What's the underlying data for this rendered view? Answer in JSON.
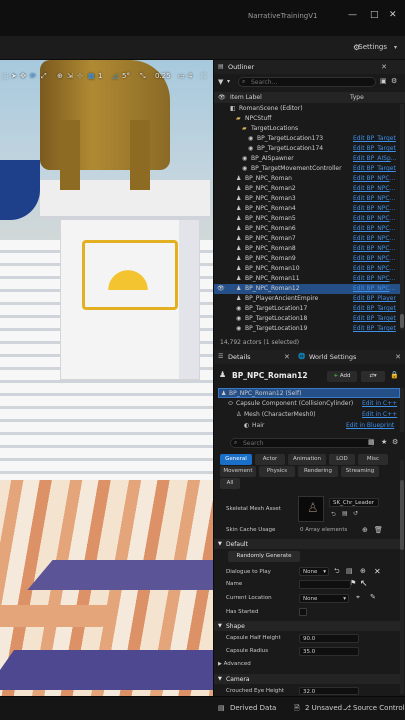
{
  "window": {
    "title": "NarrativeTrainingV1",
    "minimize": "—",
    "maximize": "□",
    "close": "✕"
  },
  "toolbar": {
    "settings_label": "Settings"
  },
  "viewport_toolbar": {
    "grid_snap": "1",
    "angle_snap": "5°",
    "scale_snap": "0.25",
    "camera_speed": "4"
  },
  "outliner": {
    "tab_label": "Outliner",
    "search_placeholder": "Search...",
    "col_label": "Item Label",
    "col_type": "Type",
    "rows": [
      {
        "label": "RomanScene (Editor)",
        "type": "",
        "indent": 1,
        "icon": "map-icon"
      },
      {
        "label": "NPCStuff",
        "type": "",
        "indent": 2,
        "icon": "folder-icon"
      },
      {
        "label": "TargetLocations",
        "type": "",
        "indent": 3,
        "icon": "folder-icon"
      },
      {
        "label": "BP_TargetLocation173",
        "type": "Edit BP_Target",
        "indent": 4,
        "icon": "actor-icon"
      },
      {
        "label": "BP_TargetLocation174",
        "type": "Edit BP_Target",
        "indent": 4,
        "icon": "actor-icon"
      },
      {
        "label": "BP_AISpawner",
        "type": "Edit BP_AISpaw",
        "indent": 3,
        "icon": "actor-icon"
      },
      {
        "label": "BP_TargetMovementController",
        "type": "Edit BP_Target",
        "indent": 3,
        "icon": "actor-icon"
      },
      {
        "label": "BP_NPC_Roman",
        "type": "Edit BP_NPC_Ro",
        "indent": 2,
        "icon": "pawn-icon"
      },
      {
        "label": "BP_NPC_Roman2",
        "type": "Edit BP_NPC_Ro",
        "indent": 2,
        "icon": "pawn-icon"
      },
      {
        "label": "BP_NPC_Roman3",
        "type": "Edit BP_NPC_Ro",
        "indent": 2,
        "icon": "pawn-icon"
      },
      {
        "label": "BP_NPC_Roman4",
        "type": "Edit BP_NPC_Ro",
        "indent": 2,
        "icon": "pawn-icon"
      },
      {
        "label": "BP_NPC_Roman5",
        "type": "Edit BP_NPC_Ro",
        "indent": 2,
        "icon": "pawn-icon"
      },
      {
        "label": "BP_NPC_Roman6",
        "type": "Edit BP_NPC_Ro",
        "indent": 2,
        "icon": "pawn-icon"
      },
      {
        "label": "BP_NPC_Roman7",
        "type": "Edit BP_NPC_Ro",
        "indent": 2,
        "icon": "pawn-icon"
      },
      {
        "label": "BP_NPC_Roman8",
        "type": "Edit BP_NPC_Ro",
        "indent": 2,
        "icon": "pawn-icon"
      },
      {
        "label": "BP_NPC_Roman9",
        "type": "Edit BP_NPC_Ro",
        "indent": 2,
        "icon": "pawn-icon"
      },
      {
        "label": "BP_NPC_Roman10",
        "type": "Edit BP_NPC_Ro",
        "indent": 2,
        "icon": "pawn-icon"
      },
      {
        "label": "BP_NPC_Roman11",
        "type": "Edit BP_NPC_Ro",
        "indent": 2,
        "icon": "pawn-icon"
      },
      {
        "label": "BP_NPC_Roman12",
        "type": "Edit BP_NPC_Ro",
        "indent": 2,
        "icon": "pawn-icon",
        "selected": true
      },
      {
        "label": "BP_PlayerAncientEmpire",
        "type": "Edit BP_Player",
        "indent": 2,
        "icon": "pawn-icon"
      },
      {
        "label": "BP_TargetLocation17",
        "type": "Edit BP_Target",
        "indent": 2,
        "icon": "actor-icon"
      },
      {
        "label": "BP_TargetLocation18",
        "type": "Edit BP_Target",
        "indent": 2,
        "icon": "actor-icon"
      },
      {
        "label": "BP_TargetLocation19",
        "type": "Edit BP_Target",
        "indent": 2,
        "icon": "actor-icon"
      }
    ],
    "status": "14,792 actors (1 selected)"
  },
  "details": {
    "tab_label": "Details",
    "world_settings_tab": "World Settings",
    "actor_name": "BP_NPC_Roman12",
    "add_label": "Add",
    "components": [
      {
        "label": "BP_NPC_Roman12 (Self)",
        "link": "",
        "indent": 0
      },
      {
        "label": "Capsule Component (CollisionCylinder)",
        "link": "Edit in C++",
        "indent": 1
      },
      {
        "label": "Mesh (CharacterMesh0)",
        "link": "Edit in C++",
        "indent": 2
      },
      {
        "label": "Hair",
        "link": "Edit in Blueprint",
        "indent": 3
      }
    ],
    "search_placeholder": "Search",
    "filter_tabs": [
      "General",
      "Actor",
      "Animation",
      "LOD",
      "Misc"
    ],
    "filter_tabs2": [
      "Movement",
      "Physics",
      "Rendering",
      "Streaming"
    ],
    "filter_all": "All",
    "skeletal_mesh_label": "Skeletal Mesh Asset",
    "skeletal_mesh_value": "SK_Chr_Leader",
    "skin_cache_label": "Skin Cache Usage",
    "skin_cache_value": "0 Array elements",
    "default_section": "Default",
    "randomly_generate": "Randomly Generate",
    "dialogue_label": "Dialogue to Play",
    "dialogue_value": "None",
    "name_label": "Name",
    "name_value": "",
    "current_location_label": "Current Location",
    "current_location_value": "None",
    "has_started_label": "Has Started",
    "shape_section": "Shape",
    "capsule_half_height_label": "Capsule Half Height",
    "capsule_half_height_value": "90.0",
    "capsule_radius_label": "Capsule Radius",
    "capsule_radius_value": "35.0",
    "advanced_label": "Advanced",
    "camera_section": "Camera",
    "crouched_eye_label": "Crouched Eye Height",
    "crouched_eye_value": "32.0"
  },
  "bottom_bar": {
    "derived_data": "Derived Data",
    "unsaved": "2 Unsaved",
    "source_control": "Source Control"
  },
  "colors": {
    "accent": "#1a6fc8",
    "selected_row": "#254f87",
    "link": "#3d8fe8",
    "folder": "#d8b357",
    "add_green": "#2f8f3a"
  }
}
